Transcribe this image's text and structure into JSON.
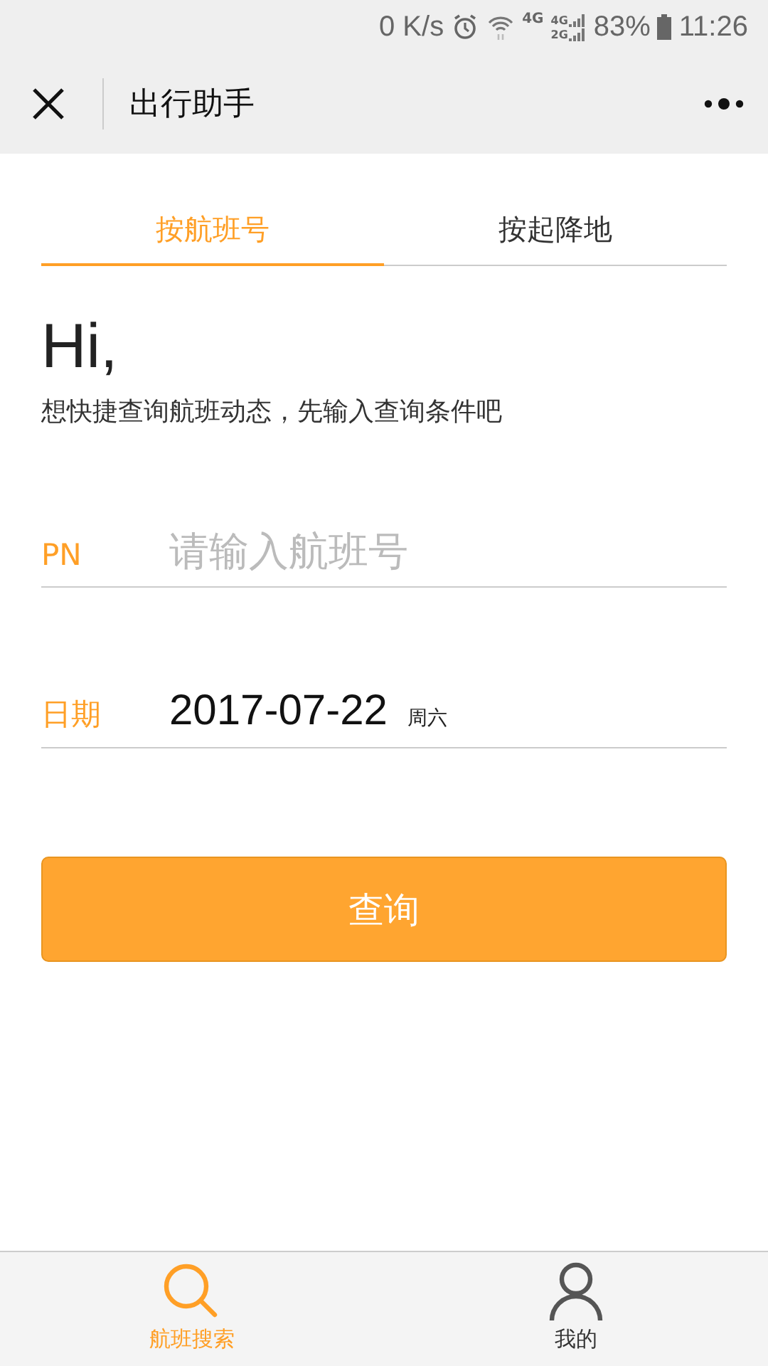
{
  "status_bar": {
    "speed": "0 K/s",
    "network_1": "4G",
    "network_2": "4G",
    "network_3": "2G",
    "battery": "83%",
    "time": "11:26"
  },
  "nav_bar": {
    "title": "出行助手"
  },
  "tabs": [
    {
      "label": "按航班号",
      "selected": true
    },
    {
      "label": "按起降地",
      "selected": false
    }
  ],
  "greeting": "Hi,",
  "subtitle": "想快捷查询航班动态，先输入查询条件吧",
  "fields": [
    {
      "label": "PN",
      "placeholder": "请输入航班号"
    },
    {
      "label": "日期",
      "value": "2017-07-22",
      "note": "周六"
    }
  ],
  "search_button": "查询",
  "bottom_nav": [
    {
      "label": "航班搜索",
      "selected": true
    },
    {
      "label": "我的",
      "selected": false
    }
  ]
}
